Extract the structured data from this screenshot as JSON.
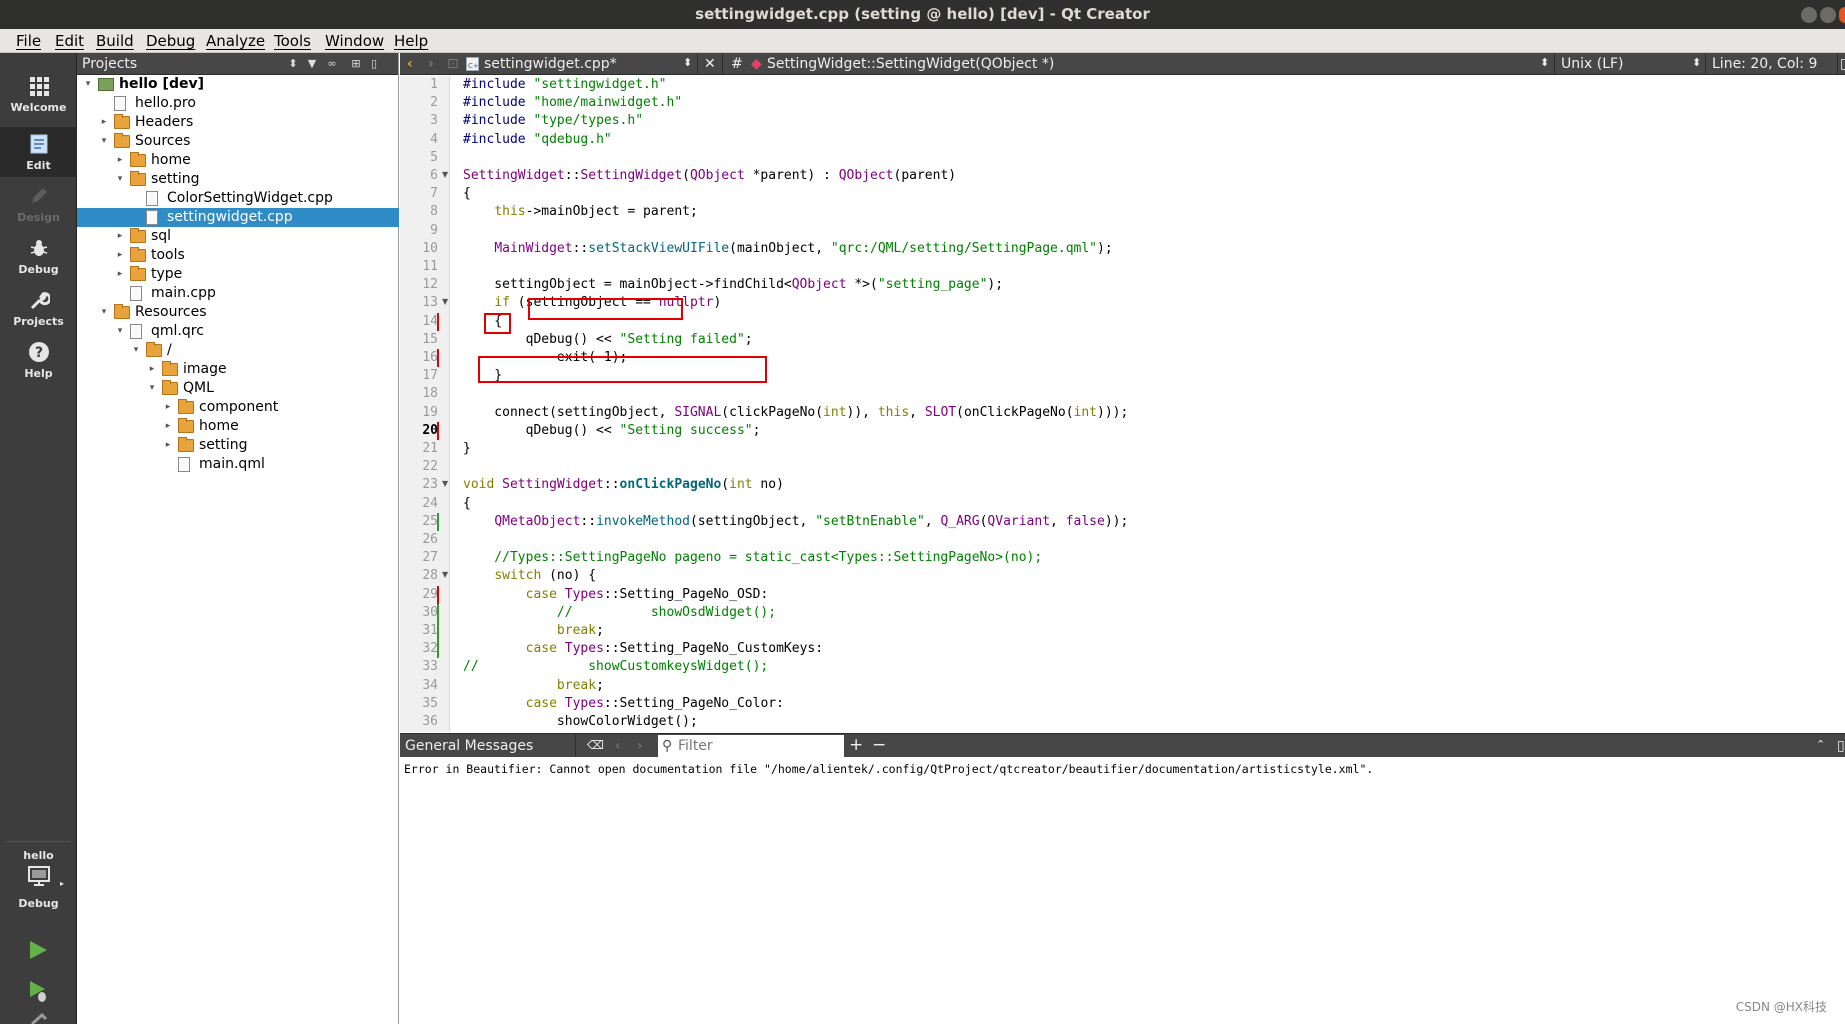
{
  "window": {
    "title": "settingwidget.cpp (setting @ hello) [dev] - Qt Creator"
  },
  "menu": [
    "File",
    "Edit",
    "Build",
    "Debug",
    "Analyze",
    "Tools",
    "Window",
    "Help"
  ],
  "modes": [
    {
      "label": "Welcome",
      "icon": "grid-icon"
    },
    {
      "label": "Edit",
      "icon": "document-icon",
      "active": true
    },
    {
      "label": "Design",
      "icon": "pen-icon",
      "disabled": true
    },
    {
      "label": "Debug",
      "icon": "bug-icon"
    },
    {
      "label": "Projects",
      "icon": "wrench-icon"
    },
    {
      "label": "Help",
      "icon": "question-icon"
    }
  ],
  "kit": {
    "project": "hello",
    "build": "Debug"
  },
  "projects_panel": {
    "title": "Projects",
    "tree": [
      {
        "label": "hello [dev]",
        "depth": 0,
        "kind": "project",
        "expanded": true,
        "bold": true
      },
      {
        "label": "hello.pro",
        "depth": 1,
        "kind": "file"
      },
      {
        "label": "Headers",
        "depth": 1,
        "kind": "folder",
        "expanded": false
      },
      {
        "label": "Sources",
        "depth": 1,
        "kind": "folder",
        "expanded": true
      },
      {
        "label": "home",
        "depth": 2,
        "kind": "folder",
        "expanded": false
      },
      {
        "label": "setting",
        "depth": 2,
        "kind": "folder",
        "expanded": true
      },
      {
        "label": "ColorSettingWidget.cpp",
        "depth": 3,
        "kind": "file"
      },
      {
        "label": "settingwidget.cpp",
        "depth": 3,
        "kind": "file",
        "selected": true
      },
      {
        "label": "sql",
        "depth": 2,
        "kind": "folder",
        "expanded": false
      },
      {
        "label": "tools",
        "depth": 2,
        "kind": "folder",
        "expanded": false
      },
      {
        "label": "type",
        "depth": 2,
        "kind": "folder",
        "expanded": false
      },
      {
        "label": "main.cpp",
        "depth": 2,
        "kind": "file"
      },
      {
        "label": "Resources",
        "depth": 1,
        "kind": "folder",
        "expanded": true
      },
      {
        "label": "qml.qrc",
        "depth": 2,
        "kind": "file",
        "expanded": true
      },
      {
        "label": "/",
        "depth": 3,
        "kind": "folder",
        "expanded": true
      },
      {
        "label": "image",
        "depth": 4,
        "kind": "folder",
        "expanded": false
      },
      {
        "label": "QML",
        "depth": 4,
        "kind": "folder",
        "expanded": true
      },
      {
        "label": "component",
        "depth": 5,
        "kind": "folder",
        "expanded": false
      },
      {
        "label": "home",
        "depth": 5,
        "kind": "folder",
        "expanded": false
      },
      {
        "label": "setting",
        "depth": 5,
        "kind": "folder",
        "expanded": false
      },
      {
        "label": "main.qml",
        "depth": 5,
        "kind": "file"
      }
    ]
  },
  "editor_toolbar": {
    "file": "settingwidget.cpp*",
    "hash": "#",
    "symbol": "SettingWidget::SettingWidget(QObject *)",
    "line_ending": "Unix (LF)",
    "position": "Line: 20, Col: 9"
  },
  "editor": {
    "current_line": 20,
    "lines": [
      "#include \"settingwidget.h\"",
      "#include \"home/mainwidget.h\"",
      "#include \"type/types.h\"",
      "#include \"qdebug.h\"",
      "",
      "SettingWidget::SettingWidget(QObject *parent) : QObject(parent)",
      "{",
      "    this->mainObject = parent;",
      "",
      "    MainWidget::setStackViewUIFile(mainObject, \"qrc:/QML/setting/SettingPage.qml\");",
      "",
      "    settingObject = mainObject->findChild<QObject *>(\"setting_page\");",
      "    if (settingObject == nullptr)",
      "    {",
      "        qDebug() << \"Setting failed\";",
      "            exit(-1);",
      "    }",
      "",
      "    connect(settingObject, SIGNAL(clickPageNo(int)), this, SLOT(onClickPageNo(int)));",
      "        qDebug() << \"Setting success\";",
      "}",
      "",
      "void SettingWidget::onClickPageNo(int no)",
      "{",
      "    QMetaObject::invokeMethod(settingObject, \"setBtnEnable\", Q_ARG(QVariant, false));",
      "",
      "    //Types::SettingPageNo pageno = static_cast<Types::SettingPageNo>(no);",
      "    switch (no) {",
      "        case Types::Setting_PageNo_OSD:",
      "            //          showOsdWidget();",
      "            break;",
      "        case Types::Setting_PageNo_CustomKeys:",
      "//              showCustomkeysWidget();",
      "            break;",
      "        case Types::Setting_PageNo_Color:",
      "            showColorWidget();"
    ]
  },
  "output": {
    "title": "General Messages",
    "filter_placeholder": "Filter",
    "message": "Error in Beautifier: Cannot open documentation file \"/home/alientek/.config/QtProject/qtcreator/beautifier/documentation/artisticstyle.xml\"."
  },
  "watermark": "CSDN @HX科技"
}
